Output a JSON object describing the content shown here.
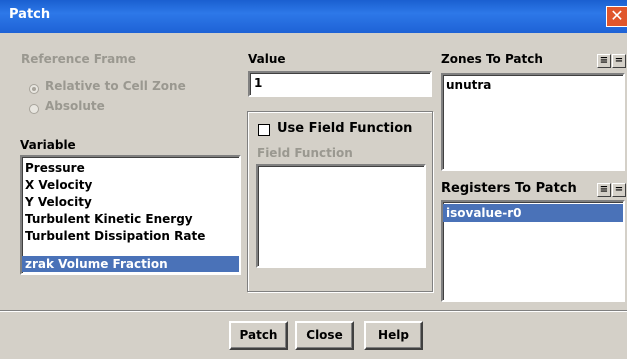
{
  "window": {
    "title": "Patch",
    "close_glyph": "✕"
  },
  "reference_frame": {
    "label": "Reference Frame",
    "options": [
      "Relative to Cell Zone",
      "Absolute"
    ],
    "selected": "Relative to Cell Zone"
  },
  "variable": {
    "label": "Variable",
    "items": [
      "Pressure",
      "X Velocity",
      "Y Velocity",
      "Turbulent Kinetic Energy",
      "Turbulent Dissipation Rate",
      "zrak Volume Fraction"
    ],
    "selected": "zrak Volume Fraction"
  },
  "value": {
    "label": "Value",
    "current": "1"
  },
  "field_function": {
    "checkbox_label": "Use Field Function",
    "list_label": "Field Function",
    "checked": false
  },
  "zones_to_patch": {
    "label": "Zones To Patch",
    "items": [
      "unutra"
    ]
  },
  "registers_to_patch": {
    "label": "Registers To Patch",
    "items": [
      "isovalue-r0"
    ],
    "selected": "isovalue-r0"
  },
  "select_all_glyph": "≡",
  "deselect_glyph": "=",
  "buttons": {
    "patch": "Patch",
    "close": "Close",
    "help": "Help"
  }
}
